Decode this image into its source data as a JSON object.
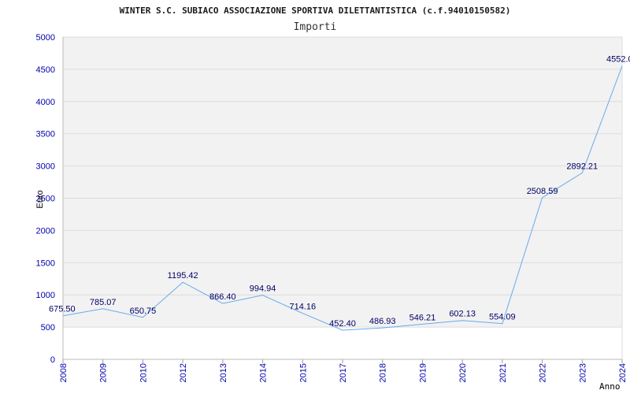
{
  "chart_data": {
    "type": "line",
    "title": "WINTER S.C. SUBIACO ASSOCIAZIONE SPORTIVA DILETTANTISTICA (c.f.94010150582)",
    "subtitle": "Importi",
    "xlabel": "Anno",
    "ylabel": "Euro",
    "ylim": [
      0,
      5000
    ],
    "yticks": [
      "0",
      "500",
      "1000",
      "1500",
      "2000",
      "2500",
      "3000",
      "3500",
      "4000",
      "4500",
      "5000"
    ],
    "categories": [
      "2008",
      "2009",
      "2010",
      "2012",
      "2013",
      "2014",
      "2015",
      "2017",
      "2018",
      "2019",
      "2020",
      "2021",
      "2022",
      "2023",
      "2024"
    ],
    "values": [
      675.5,
      785.07,
      650.75,
      1195.42,
      866.4,
      994.94,
      714.16,
      452.4,
      486.93,
      546.21,
      602.13,
      554.09,
      2508.59,
      2892.21,
      4552.0
    ],
    "labels": [
      "675.50",
      "785.07",
      "650.75",
      "1195.42",
      "866.40",
      "994.94",
      "714.16",
      "452.40",
      "486.93",
      "546.21",
      "602.13",
      "554.09",
      "2508.59",
      "2892.21",
      "4552.0"
    ],
    "grid": true,
    "colors": {
      "line": "#66aaee",
      "band": "#f2f2f2",
      "grid": "#dddddd"
    }
  }
}
